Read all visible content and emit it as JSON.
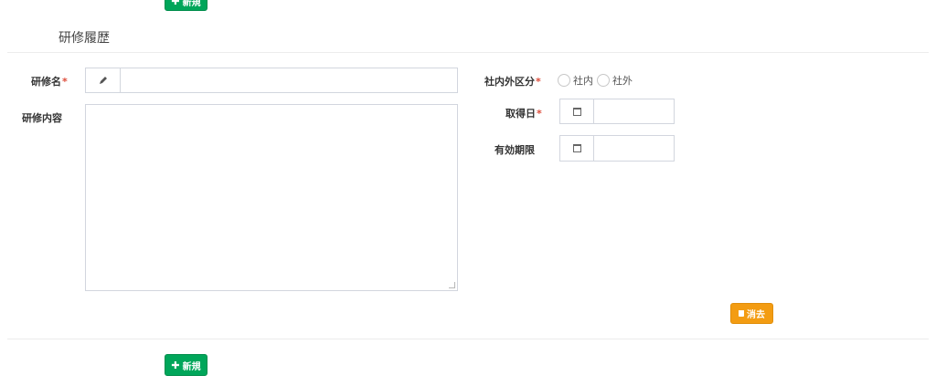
{
  "buttons": {
    "new_label": "新規",
    "delete_label": "消去"
  },
  "section": {
    "title": "研修履歴"
  },
  "form": {
    "training_name_label": "研修名",
    "training_content_label": "研修内容",
    "category_label": "社内外区分",
    "category_options": [
      "社内",
      "社外"
    ],
    "acquired_date_label": "取得日",
    "validity_label": "有効期限",
    "required_mark": "*"
  },
  "icons": {
    "pencil": "pencil-icon",
    "calendar": "calendar-icon",
    "plus": "plus-icon",
    "trash": "trash-icon"
  },
  "colors": {
    "primary_green": "#00a65a",
    "warning_orange": "#f39c12",
    "required_red": "#dd4b39"
  }
}
